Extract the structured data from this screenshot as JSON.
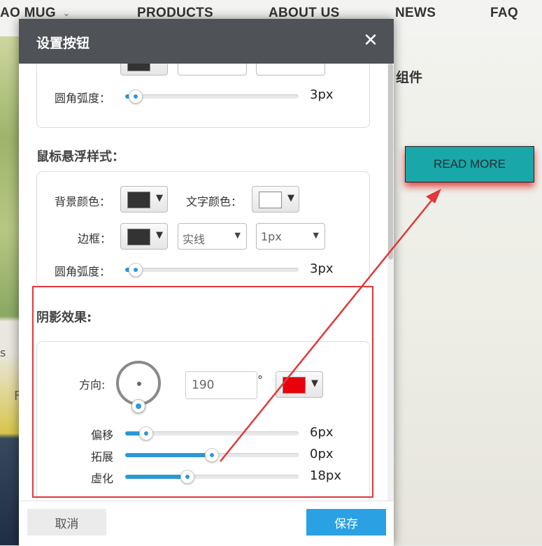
{
  "background": {
    "nav": {
      "items": [
        "AO MUG",
        "PRODUCTS",
        "ABOUT US",
        "NEWS",
        "FAQ"
      ],
      "dropdown_glyph": "⌄"
    },
    "heading": "组件",
    "read_more_label": "READ MORE",
    "left_label": "s",
    "left_label2": "F"
  },
  "modal": {
    "title": "设置按钮",
    "close_glyph": "✕",
    "top_partial": {
      "radius_label": "圆角弧度：",
      "radius_value": "3px",
      "radius_level": 0.06
    },
    "hover": {
      "title": "鼠标悬浮样式：",
      "bg_color_label": "背景颜色：",
      "bg_color": "#333333",
      "text_color_label": "文字颜色：",
      "text_color": "#ffffff",
      "border_label": "边框：",
      "border_color": "#333333",
      "border_style": "实线",
      "border_width": "1px",
      "radius_label": "圆角弧度：",
      "radius_value": "3px",
      "radius_level": 0.06
    },
    "shadow": {
      "title": "阴影效果:",
      "direction_label": "方向:",
      "direction_value": "190",
      "degree_symbol": "°",
      "color": "#e8000b",
      "offset_label": "偏移",
      "offset_value": "6px",
      "offset_level": 0.12,
      "spread_label": "拓展",
      "spread_value": "0px",
      "spread_level": 0.5,
      "blur_label": "虚化",
      "blur_value": "18px",
      "blur_level": 0.36
    },
    "footer": {
      "cancel_label": "取消",
      "save_label": "保存"
    }
  },
  "colors": {
    "accent": "#2aa1e3",
    "annotation": "#e0383b",
    "header": "#4f5257"
  },
  "icons": [
    "close-icon",
    "caret-down-icon",
    "dial-icon"
  ]
}
